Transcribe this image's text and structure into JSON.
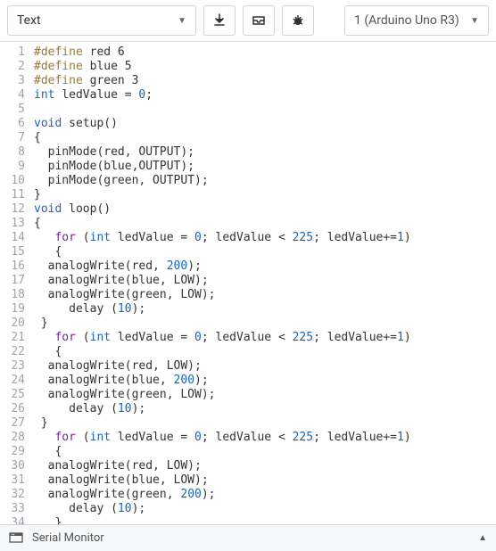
{
  "toolbar": {
    "mode_label": "Text",
    "device_label": "1 (Arduino Uno R3)"
  },
  "statusbar": {
    "label": "Serial Monitor"
  },
  "code": {
    "lines": [
      [
        {
          "t": "#define",
          "c": "kw-pp"
        },
        {
          "t": " red 6"
        }
      ],
      [
        {
          "t": "#define",
          "c": "kw-pp"
        },
        {
          "t": " blue 5"
        }
      ],
      [
        {
          "t": "#define",
          "c": "kw-pp"
        },
        {
          "t": " green 3"
        }
      ],
      [
        {
          "t": "int",
          "c": "kw-type"
        },
        {
          "t": " ledValue = "
        },
        {
          "t": "0",
          "c": "num"
        },
        {
          "t": ";"
        }
      ],
      [],
      [
        {
          "t": "void",
          "c": "kw-type"
        },
        {
          "t": " setup()"
        }
      ],
      [
        {
          "t": "{"
        }
      ],
      [
        {
          "t": "  pinMode(red, OUTPUT);"
        }
      ],
      [
        {
          "t": "  pinMode(blue,OUTPUT);"
        }
      ],
      [
        {
          "t": "  pinMode(green, OUTPUT);"
        }
      ],
      [
        {
          "t": "}"
        }
      ],
      [
        {
          "t": "void",
          "c": "kw-type"
        },
        {
          "t": " loop()"
        }
      ],
      [
        {
          "t": "{"
        }
      ],
      [
        {
          "t": "   "
        },
        {
          "t": "for",
          "c": "kw-flow"
        },
        {
          "t": " ("
        },
        {
          "t": "int",
          "c": "kw-type"
        },
        {
          "t": " ledValue = "
        },
        {
          "t": "0",
          "c": "num"
        },
        {
          "t": "; ledValue < "
        },
        {
          "t": "225",
          "c": "num"
        },
        {
          "t": "; ledValue+="
        },
        {
          "t": "1",
          "c": "num"
        },
        {
          "t": ")"
        }
      ],
      [
        {
          "t": "   {"
        }
      ],
      [
        {
          "t": "  analogWrite(red, "
        },
        {
          "t": "200",
          "c": "num"
        },
        {
          "t": ");"
        }
      ],
      [
        {
          "t": "  analogWrite(blue, LOW);"
        }
      ],
      [
        {
          "t": "  analogWrite(green, LOW);"
        }
      ],
      [
        {
          "t": "     delay ("
        },
        {
          "t": "10",
          "c": "num"
        },
        {
          "t": ");"
        }
      ],
      [
        {
          "t": " }"
        }
      ],
      [
        {
          "t": "   "
        },
        {
          "t": "for",
          "c": "kw-flow"
        },
        {
          "t": " ("
        },
        {
          "t": "int",
          "c": "kw-type"
        },
        {
          "t": " ledValue = "
        },
        {
          "t": "0",
          "c": "num"
        },
        {
          "t": "; ledValue < "
        },
        {
          "t": "225",
          "c": "num"
        },
        {
          "t": "; ledValue+="
        },
        {
          "t": "1",
          "c": "num"
        },
        {
          "t": ")"
        }
      ],
      [
        {
          "t": "   {"
        }
      ],
      [
        {
          "t": "  analogWrite(red, LOW);"
        }
      ],
      [
        {
          "t": "  analogWrite(blue, "
        },
        {
          "t": "200",
          "c": "num"
        },
        {
          "t": ");"
        }
      ],
      [
        {
          "t": "  analogWrite(green, LOW);"
        }
      ],
      [
        {
          "t": "     delay ("
        },
        {
          "t": "10",
          "c": "num"
        },
        {
          "t": ");"
        }
      ],
      [
        {
          "t": " }"
        }
      ],
      [
        {
          "t": "   "
        },
        {
          "t": "for",
          "c": "kw-flow"
        },
        {
          "t": " ("
        },
        {
          "t": "int",
          "c": "kw-type"
        },
        {
          "t": " ledValue = "
        },
        {
          "t": "0",
          "c": "num"
        },
        {
          "t": "; ledValue < "
        },
        {
          "t": "225",
          "c": "num"
        },
        {
          "t": "; ledValue+="
        },
        {
          "t": "1",
          "c": "num"
        },
        {
          "t": ")"
        }
      ],
      [
        {
          "t": "   {"
        }
      ],
      [
        {
          "t": "  analogWrite(red, LOW);"
        }
      ],
      [
        {
          "t": "  analogWrite(blue, LOW);"
        }
      ],
      [
        {
          "t": "  analogWrite(green, "
        },
        {
          "t": "200",
          "c": "num"
        },
        {
          "t": ");"
        }
      ],
      [
        {
          "t": "     delay ("
        },
        {
          "t": "10",
          "c": "num"
        },
        {
          "t": ");"
        }
      ],
      [
        {
          "t": "   }"
        }
      ],
      [
        {
          "t": "  }"
        }
      ]
    ]
  }
}
